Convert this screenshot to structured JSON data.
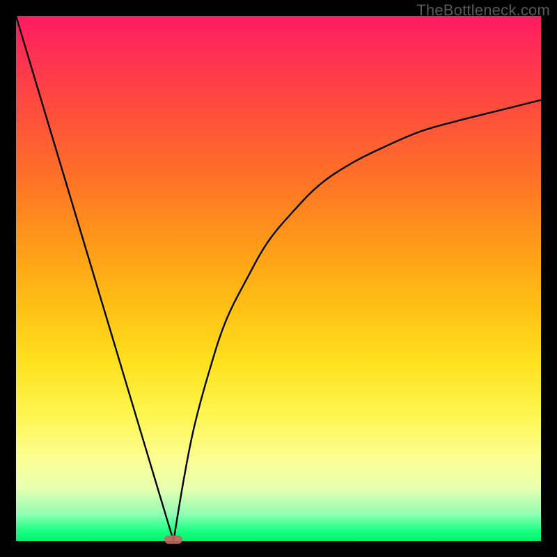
{
  "watermark": "TheBottleneck.com",
  "chart_data": {
    "type": "line",
    "title": "",
    "xlabel": "",
    "ylabel": "",
    "xlim": [
      0,
      100
    ],
    "ylim": [
      0,
      100
    ],
    "legend": false,
    "grid": false,
    "background": "red-yellow-green vertical gradient",
    "minimum_marker": {
      "x": 30,
      "y": 0
    },
    "series": [
      {
        "name": "left-branch",
        "x": [
          0,
          3,
          6,
          9,
          12,
          15,
          18,
          21,
          24,
          27,
          30
        ],
        "y": [
          100,
          90,
          80,
          70,
          60,
          50,
          40,
          30,
          20,
          10,
          0
        ]
      },
      {
        "name": "right-branch",
        "x": [
          30,
          32,
          34,
          37,
          40,
          44,
          48,
          53,
          58,
          64,
          70,
          77,
          84,
          92,
          100
        ],
        "y": [
          0,
          12,
          22,
          33,
          42,
          50,
          57,
          63,
          68,
          72,
          75,
          78,
          80,
          82,
          84
        ]
      }
    ]
  }
}
